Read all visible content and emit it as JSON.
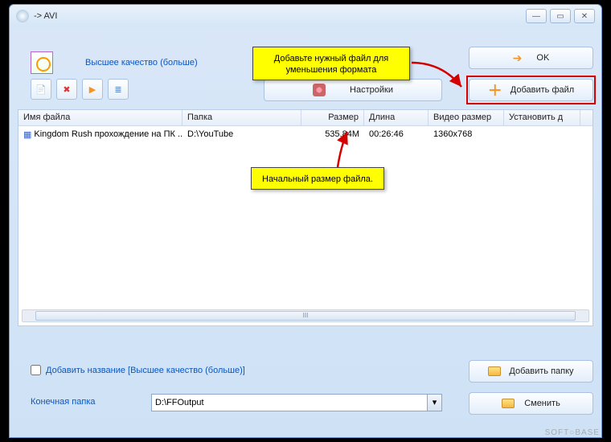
{
  "window": {
    "title": "-> AVI"
  },
  "top": {
    "quality_link": "Высшее качество (больше)",
    "ok_label": "OK",
    "add_file_label": "Добавить файл",
    "settings_label": "Настройки"
  },
  "table": {
    "headers": {
      "filename": "Имя файла",
      "folder": "Папка",
      "size": "Размер",
      "length": "Длина",
      "video_size": "Видео размер",
      "set": "Установить д"
    },
    "rows": [
      {
        "filename": "Kingdom Rush прохождение на ПК ...",
        "folder": "D:\\YouTube",
        "size": "535.84M",
        "length": "00:26:46",
        "video_size": "1360x768"
      }
    ]
  },
  "callouts": {
    "add_hint": "Добавьте нужный файл для уменьшения формата",
    "size_hint": "Начальный размер файла."
  },
  "bottom": {
    "checkbox_label": "Добавить название [Высшее качество (больше)]",
    "add_folder_label": "Добавить папку",
    "output_label": "Конечная папка",
    "output_path": "D:\\FFOutput",
    "change_label": "Сменить"
  },
  "watermark": "SOFT○BASE"
}
